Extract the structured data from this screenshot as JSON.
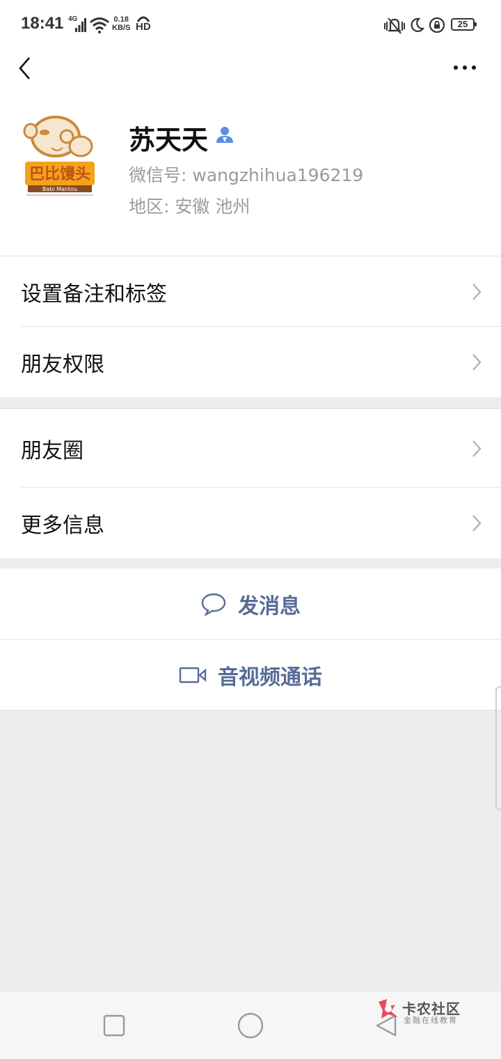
{
  "status_bar": {
    "time": "18:41",
    "network": "4G",
    "speed_value": "0.18",
    "speed_unit": "KB/S",
    "hd": "HD",
    "battery": "25"
  },
  "profile": {
    "name": "苏天天",
    "wechat_id": "微信号: wangzhihua196219",
    "region": "地区: 安徽  池州",
    "avatar_text": "巴比馒头",
    "avatar_subtext": "Babi Mantou"
  },
  "menu_group_1": [
    {
      "label": "设置备注和标签"
    },
    {
      "label": "朋友权限"
    }
  ],
  "menu_group_2": [
    {
      "label": "朋友圈"
    },
    {
      "label": "更多信息"
    }
  ],
  "actions": {
    "send_message": "发消息",
    "video_call": "音视频通话"
  },
  "watermark": {
    "title": "卡农社区",
    "subtitle": "金融在线教育"
  },
  "colors": {
    "link_blue": "#576b95",
    "verify_blue": "#5b8fe0",
    "background": "#ededed"
  }
}
